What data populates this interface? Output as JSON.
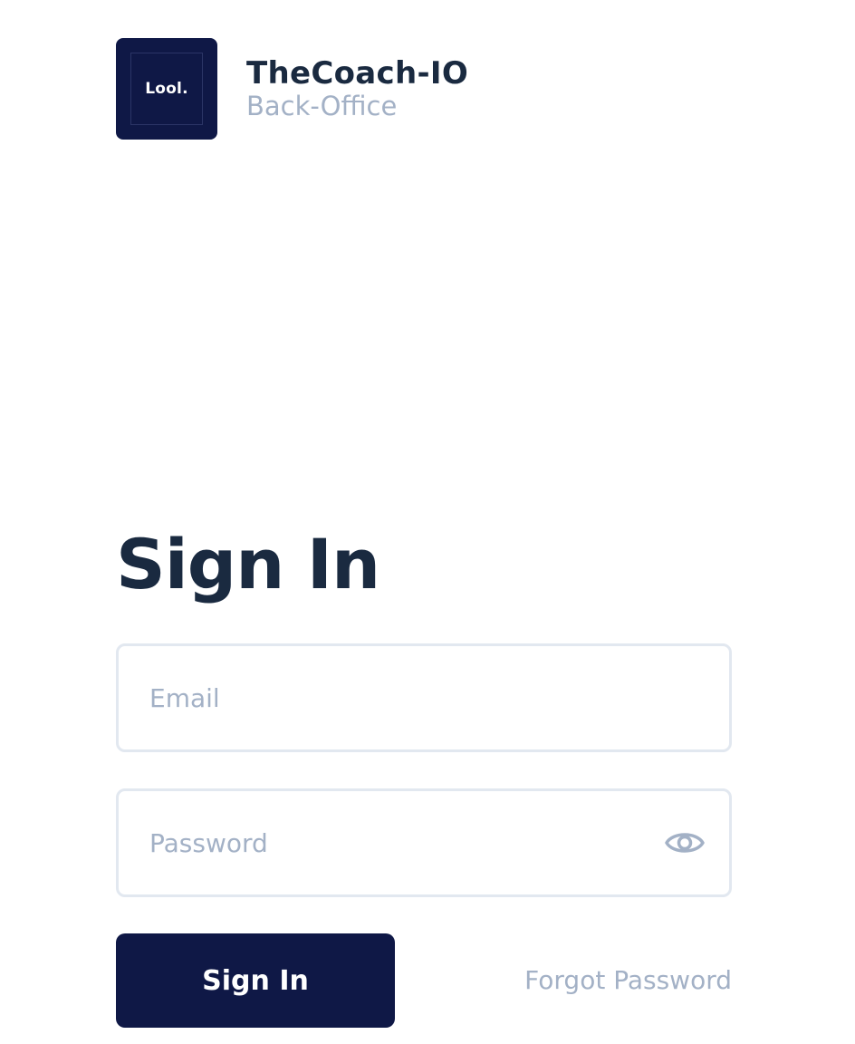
{
  "brand": {
    "logo_text": "Lool.",
    "name": "TheCoach-IO",
    "subtitle": "Back-Office"
  },
  "form": {
    "title": "Sign In",
    "email": {
      "value": "",
      "placeholder": "Email"
    },
    "password": {
      "value": "",
      "placeholder": "Password",
      "toggle_icon": "eye-icon"
    },
    "submit_label": "Sign In",
    "forgot_label": "Forgot Password"
  },
  "colors": {
    "primary": "#0f1846",
    "heading": "#1a2a40",
    "muted": "#a3b1c6",
    "border": "#e2e8f0",
    "background": "#ffffff"
  }
}
